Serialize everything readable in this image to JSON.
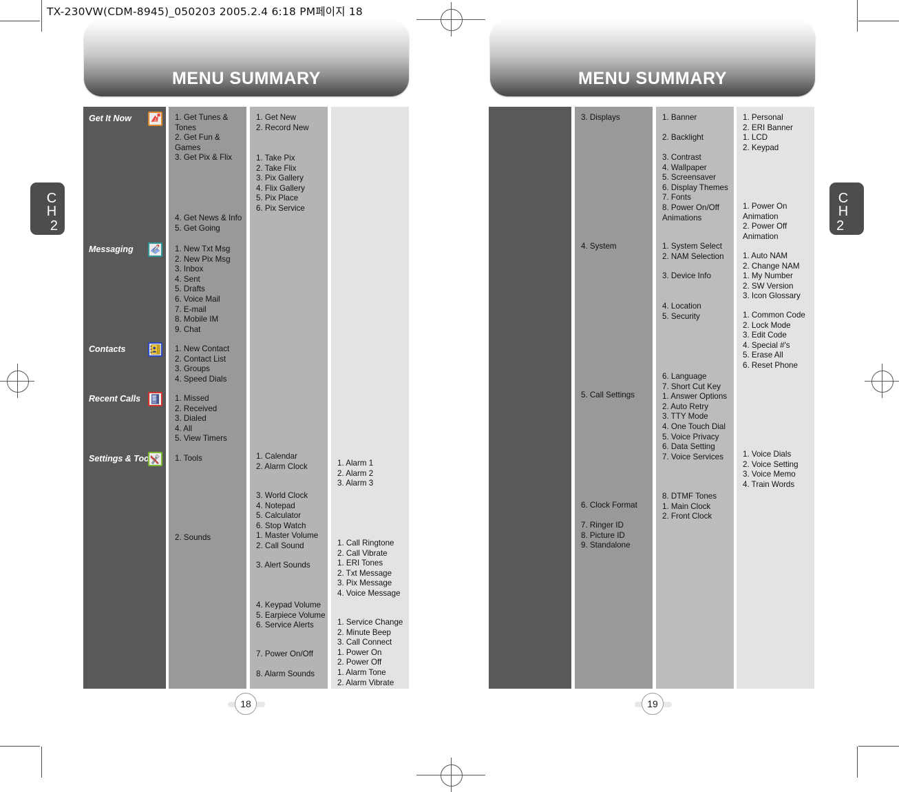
{
  "slug": "TX-230VW(CDM-8945)_050203  2005.2.4 6:18 PM페이지 18",
  "left_page": {
    "banner_title": "MENU SUMMARY",
    "chapter_tab": {
      "label": "CH",
      "number": "2"
    },
    "page_number": "18",
    "categories": [
      {
        "name": "Get It Now",
        "icon": "get-it-now-icon"
      },
      {
        "name": "Messaging",
        "icon": "messaging-icon"
      },
      {
        "name": "Contacts",
        "icon": "contacts-icon"
      },
      {
        "name": "Recent Calls",
        "icon": "recent-calls-icon"
      },
      {
        "name": "Settings & Tools",
        "icon": "settings-tools-icon"
      }
    ],
    "col2": [
      "1. Get Tunes &\n    Tones\n2. Get Fun &\n    Games\n3. Get Pix & Flix",
      "4. Get News & Info\n5. Get Going",
      "1. New Txt Msg\n2. New Pix Msg\n3. Inbox\n4. Sent\n5. Drafts\n6. Voice Mail\n7. E-mail\n8. Mobile IM\n9. Chat",
      "1. New Contact\n2. Contact List\n3. Groups\n4. Speed Dials",
      "1. Missed\n2. Received\n3. Dialed\n4. All\n5. View Timers",
      "1. Tools",
      "2. Sounds"
    ],
    "col3": [
      "1. Get New\n2. Record New",
      "1. Take Pix\n2. Take Flix\n3. Pix Gallery\n4. Flix Gallery\n5. Pix Place\n6. Pix Service",
      "1. Calendar\n2. Alarm Clock",
      "3. World Clock\n4. Notepad\n5. Calculator\n6. Stop Watch\n1. Master Volume\n2. Call Sound",
      "3. Alert Sounds",
      "4. Keypad Volume\n5. Earpiece Volume\n6. Service Alerts",
      "7. Power On/Off",
      "8. Alarm Sounds"
    ],
    "col4": [
      "1. Alarm 1\n2. Alarm 2\n3. Alarm 3",
      "1. Call Ringtone\n2. Call Vibrate\n1. ERI Tones\n2. Txt Message\n3. Pix Message\n4. Voice Message",
      "1. Service Change\n2. Minute Beep\n3. Call Connect\n1. Power On\n2. Power Off\n1. Alarm Tone\n2. Alarm Vibrate"
    ]
  },
  "right_page": {
    "banner_title": "MENU SUMMARY",
    "chapter_tab": {
      "label": "CH",
      "number": "2"
    },
    "page_number": "19",
    "col2": [
      "3. Displays",
      "4. System",
      "5. Call Settings",
      "6. Clock Format",
      "7. Ringer ID\n8. Picture ID\n9. Standalone"
    ],
    "col3": [
      "1. Banner",
      "2. Backlight",
      "3. Contrast\n4. Wallpaper\n5. Screensaver\n6. Display Themes\n7. Fonts\n8. Power On/Off\n    Animations",
      "1. System Select\n2. NAM Selection",
      "3. Device Info",
      "4. Location\n5. Security",
      "6. Language\n7. Short Cut Key\n1. Answer Options\n2. Auto Retry\n3. TTY Mode\n4. One Touch Dial\n5. Voice Privacy\n6. Data Setting\n7. Voice Services",
      "8. DTMF Tones\n1. Main Clock\n2. Front Clock"
    ],
    "col4": [
      "1. Personal\n2. ERI Banner\n1. LCD\n2. Keypad",
      "1. Power On\n    Animation\n2. Power Off\n    Animation",
      "1. Auto NAM\n2. Change NAM\n1. My Number\n2. SW Version\n3. Icon Glossary",
      "1. Common Code\n2. Lock Mode\n3. Edit Code\n4. Special #'s\n5. Erase All\n6. Reset Phone",
      "1. Voice Dials\n2. Voice Setting\n3. Voice Memo\n4. Train Words"
    ]
  },
  "colors": {
    "col1_bg": "#595959",
    "col2_bg": "#999999",
    "col3_bg": "#b4b4b4",
    "col4_bg": "#e3e3e3",
    "tab_bg": "#4d4d4d"
  }
}
